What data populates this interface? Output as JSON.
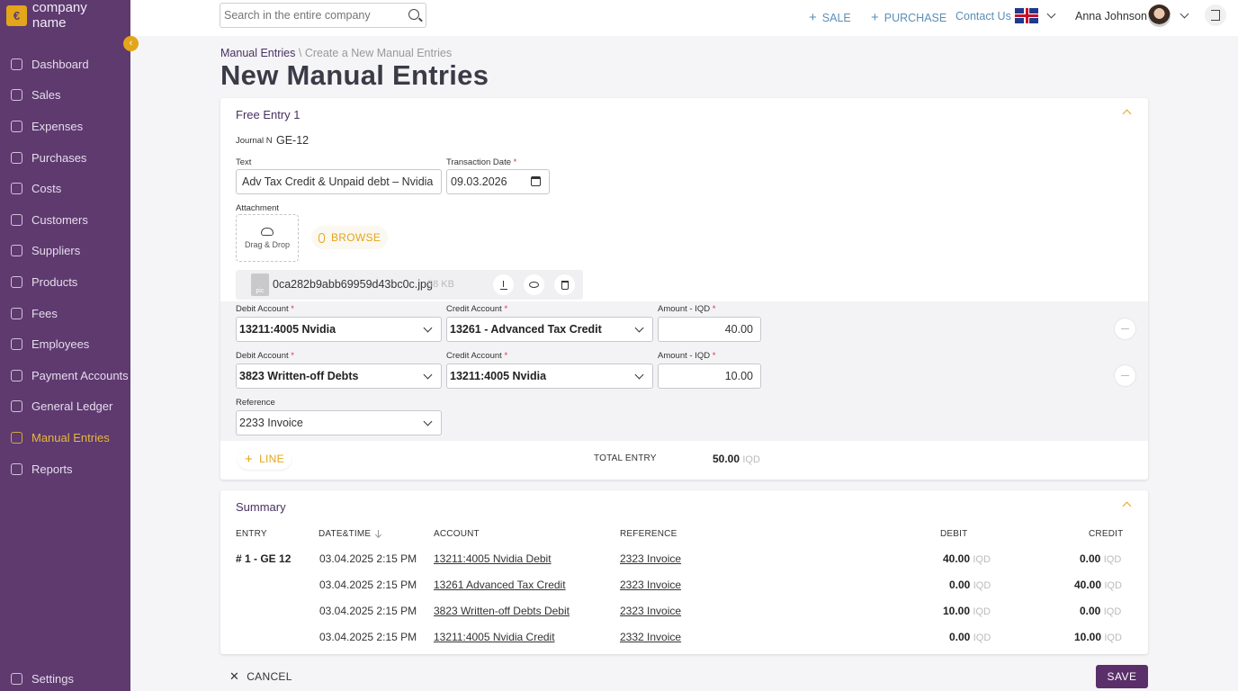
{
  "brand": {
    "name": "company name",
    "logo_glyph": "€"
  },
  "sidebar": {
    "items": [
      {
        "label": "Dashboard",
        "icon": "dashboard-icon"
      },
      {
        "label": "Sales",
        "icon": "sales-icon"
      },
      {
        "label": "Expenses",
        "icon": "expenses-icon"
      },
      {
        "label": "Purchases",
        "icon": "purchases-icon"
      },
      {
        "label": "Costs",
        "icon": "costs-icon"
      },
      {
        "label": "Customers",
        "icon": "customers-icon"
      },
      {
        "label": "Suppliers",
        "icon": "suppliers-icon"
      },
      {
        "label": "Products",
        "icon": "products-icon"
      },
      {
        "label": "Fees",
        "icon": "fees-icon"
      },
      {
        "label": "Employees",
        "icon": "employees-icon"
      },
      {
        "label": "Payment Accounts",
        "icon": "bank-icon"
      },
      {
        "label": "General Ledger",
        "icon": "ledger-icon"
      },
      {
        "label": "Manual Entries",
        "icon": "book-icon",
        "active": true
      },
      {
        "label": "Reports",
        "icon": "reports-icon"
      }
    ],
    "settings_label": "Settings"
  },
  "topbar": {
    "search_placeholder": "Search in the entire company",
    "sale_label": "SALE",
    "purchase_label": "PURCHASE",
    "contact_label": "Contact Us",
    "language_icon": "uk-flag-icon",
    "user_name": "Anna Johnson"
  },
  "breadcrumb": {
    "root": "Manual Entries",
    "separator": "\\",
    "current": "Create a New Manual Entries"
  },
  "page_title": "New Manual Entries",
  "entry": {
    "title": "Free Entry 1",
    "journal_label": "Journal N",
    "journal_value": "GE-12",
    "text_label": "Text",
    "text_value": "Adv Tax Credit & Unpaid debt – Nvidia",
    "date_label": "Transaction Date",
    "date_value": "09.03.2026",
    "attachment_label": "Attachment",
    "dropzone_label": "Drag & Drop",
    "browse_label": "BROWSE",
    "file": {
      "name": "0ca282b9abb69959d43bc0c.jpg",
      "size": "58 KB",
      "thumb_label": "pic"
    },
    "lines": [
      {
        "debit_label": "Debit Account",
        "debit": "13211:4005 Nvidia",
        "credit_label": "Credit Account",
        "credit": "13261 - Advanced Tax Credit",
        "amount_label": "Amount - IQD",
        "amount": "40.00"
      },
      {
        "debit_label": "Debit Account",
        "debit": "3823 Written-off Debts",
        "credit_label": "Credit Account",
        "credit": "13211:4005 Nvidia",
        "amount_label": "Amount - IQD",
        "amount": "10.00"
      }
    ],
    "reference_label": "Reference",
    "reference_value": "2233 Invoice",
    "add_line_label": "LINE",
    "total_label": "TOTAL ENTRY",
    "total_value": "50.00",
    "currency": "IQD"
  },
  "summary": {
    "title": "Summary",
    "headers": {
      "entry": "ENTRY",
      "datetime": "DATE&TIME",
      "account": "ACCOUNT",
      "reference": "REFERENCE",
      "debit": "DEBIT",
      "credit": "CREDIT"
    },
    "entry_label": "# 1 - GE 12",
    "currency": "IQD",
    "rows": [
      {
        "datetime": "03.04.2025 2:15 PM",
        "account_code": "13211:4005",
        "account_name": "Nvidia Debit",
        "reference": "2323 Invoice",
        "debit": "40.00",
        "credit": "0.00"
      },
      {
        "datetime": "03.04.2025 2:15 PM",
        "account_code": "13261",
        "account_name": "Advanced Tax Credit",
        "reference": "2323 Invoice",
        "debit": "0.00",
        "credit": "40.00"
      },
      {
        "datetime": "03.04.2025 2:15 PM",
        "account_code": "3823",
        "account_name": "Written-off Debts Debit",
        "reference": "2323 Invoice",
        "debit": "10.00",
        "credit": "0.00"
      },
      {
        "datetime": "03.04.2025 2:15 PM",
        "account_code": "13211:4005",
        "account_name": "Nvidia Credit",
        "reference": "2332 Invoice",
        "debit": "0.00",
        "credit": "10.00"
      }
    ]
  },
  "footer": {
    "cancel_label": "CANCEL",
    "save_label": "SAVE"
  },
  "colors": {
    "sidebar": "#5e3a6f",
    "accent": "#e3a51a",
    "primary": "#5a2f6a",
    "link": "#5a8fb8"
  }
}
